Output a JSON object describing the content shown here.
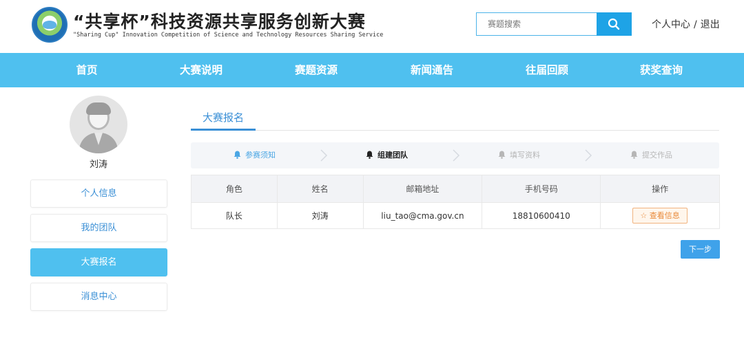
{
  "header": {
    "title": "“共享杯”科技资源共享服务创新大赛",
    "subtitle": "\"Sharing Cup\"  Innovation Competition of Science and Technology Resources Sharing Service",
    "search_placeholder": "赛题搜索",
    "search_icon": "search-icon",
    "user_center": "个人中心",
    "separator": "/",
    "logout": "退出"
  },
  "nav": {
    "items": [
      "首页",
      "大赛说明",
      "赛题资源",
      "新闻通告",
      "往届回顾",
      "获奖查询"
    ]
  },
  "sidebar": {
    "user_name": "刘涛",
    "items": [
      "个人信息",
      "我的团队",
      "大赛报名",
      "消息中心"
    ],
    "active_index": 2
  },
  "main": {
    "tab": "大赛报名",
    "steps": [
      {
        "label": "参赛须知",
        "state": "done"
      },
      {
        "label": "组建团队",
        "state": "current"
      },
      {
        "label": "填写资料",
        "state": "todo"
      },
      {
        "label": "提交作品",
        "state": "todo"
      }
    ],
    "table": {
      "headers": [
        "角色",
        "姓名",
        "邮箱地址",
        "手机号码",
        "操作"
      ],
      "rows": [
        {
          "role": "队长",
          "name": "刘涛",
          "email": "liu_tao@cma.gov.cn",
          "phone": "18810600410",
          "action": "☆ 查看信息"
        }
      ]
    },
    "next_button": "下一步"
  },
  "colors": {
    "nav_bg": "#4fc0ef",
    "accent": "#3a8fd6",
    "search_button": "#1ea3e6",
    "view_button_text": "#e88a3a"
  }
}
